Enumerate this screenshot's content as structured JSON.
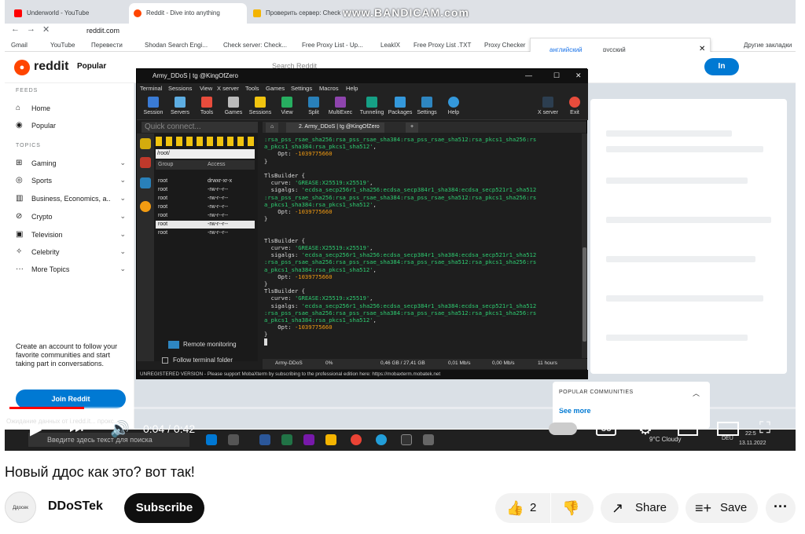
{
  "browser": {
    "tabs": [
      {
        "label": "Underworld - YouTube",
        "icon": "youtube-icon"
      },
      {
        "label": "Reddit - Dive into anything",
        "icon": "reddit-icon"
      },
      {
        "label": "Проверить сервер: Check h",
        "icon": "check-host-icon"
      }
    ],
    "url": "reddit.com",
    "bookmarks": [
      "Gmail",
      "YouTube",
      "Перевести",
      "Shodan Search Engi...",
      "Check server: Check...",
      "Free Proxy List - Up...",
      "LeakIX",
      "Free Proxy List .TXT",
      "Proxy Checker",
      "Другие закладки"
    ],
    "watermark": "www.BANDICAM.com"
  },
  "translate_popup": {
    "lang1": "английский",
    "lang2": "русский"
  },
  "reddit": {
    "brand": "reddit",
    "header_feed": "Popular",
    "search_placeholder": "Search Reddit",
    "login": "In",
    "feeds_title": "FEEDS",
    "feeds": [
      "Home",
      "Popular"
    ],
    "topics_title": "TOPICS",
    "topics": [
      "Gaming",
      "Sports",
      "Business, Economics, a...",
      "Crypto",
      "Television",
      "Celebrity",
      "More Topics"
    ],
    "signup_text": "Create an account to follow your favorite communities and start taking part in conversations.",
    "join_button": "Join Reddit",
    "popular_communities": "POPULAR COMMUNITIES",
    "see_more": "See more"
  },
  "terminal": {
    "title": "Army_DDoS | tg @KingOfZero",
    "menu": [
      "Terminal",
      "Sessions",
      "View",
      "X server",
      "Tools",
      "Games",
      "Settings",
      "Macros",
      "Help"
    ],
    "tools": [
      "Session",
      "Servers",
      "Tools",
      "Games",
      "Sessions",
      "View",
      "Split",
      "MultiExec",
      "Tunneling",
      "Packages",
      "Settings",
      "Help"
    ],
    "tools_right": [
      "X server",
      "Exit"
    ],
    "quick_connect": "Quick connect...",
    "path": "/root/",
    "col_group": "Group",
    "col_access": "Access",
    "files": [
      {
        "group": "root",
        "access": "drwxr-xr-x"
      },
      {
        "group": "root",
        "access": "-rw-r--r--"
      },
      {
        "group": "root",
        "access": "-rw-r--r--"
      },
      {
        "group": "root",
        "access": "-rw-r--r--"
      },
      {
        "group": "root",
        "access": "-rw-r--r--"
      },
      {
        "group": "root",
        "access": "-rw-r--r--"
      },
      {
        "group": "root",
        "access": "-rw-r--r--"
      }
    ],
    "remote_monitoring": "Remote monitoring",
    "follow_folder": "Follow terminal folder",
    "session_tab": "2. Army_DDoS | tg @KingOfZero",
    "status": {
      "name": "Army-DDoS",
      "cpu": "0%",
      "mem": "0,46 GB / 27,41 GB",
      "up": "0,01 Mb/s",
      "down": "0,00 Mb/s",
      "time": "11 hours"
    },
    "footer": "UNREGISTERED VERSION  -  Please support MobaXterm by subscribing to the professional edition here:  https://mobaxterm.mobatek.net"
  },
  "taskbar": {
    "search": "Введите здесь текст для поиска",
    "weather": "9°C  Cloudy",
    "lang": "DEU",
    "time": "22:5",
    "date": "13.11.2022"
  },
  "player": {
    "time": "0:04 / 0:42",
    "overlay_text": "Ожидание данных от i.redd.it... прокс..."
  },
  "video": {
    "title": "Новый ддос как это? вот так!"
  },
  "channel": {
    "name": "DDoSTek",
    "avatar_text": "Ддосек",
    "subscribe": "Subscribe"
  },
  "actions": {
    "likes": "2",
    "share": "Share",
    "save": "Save"
  }
}
